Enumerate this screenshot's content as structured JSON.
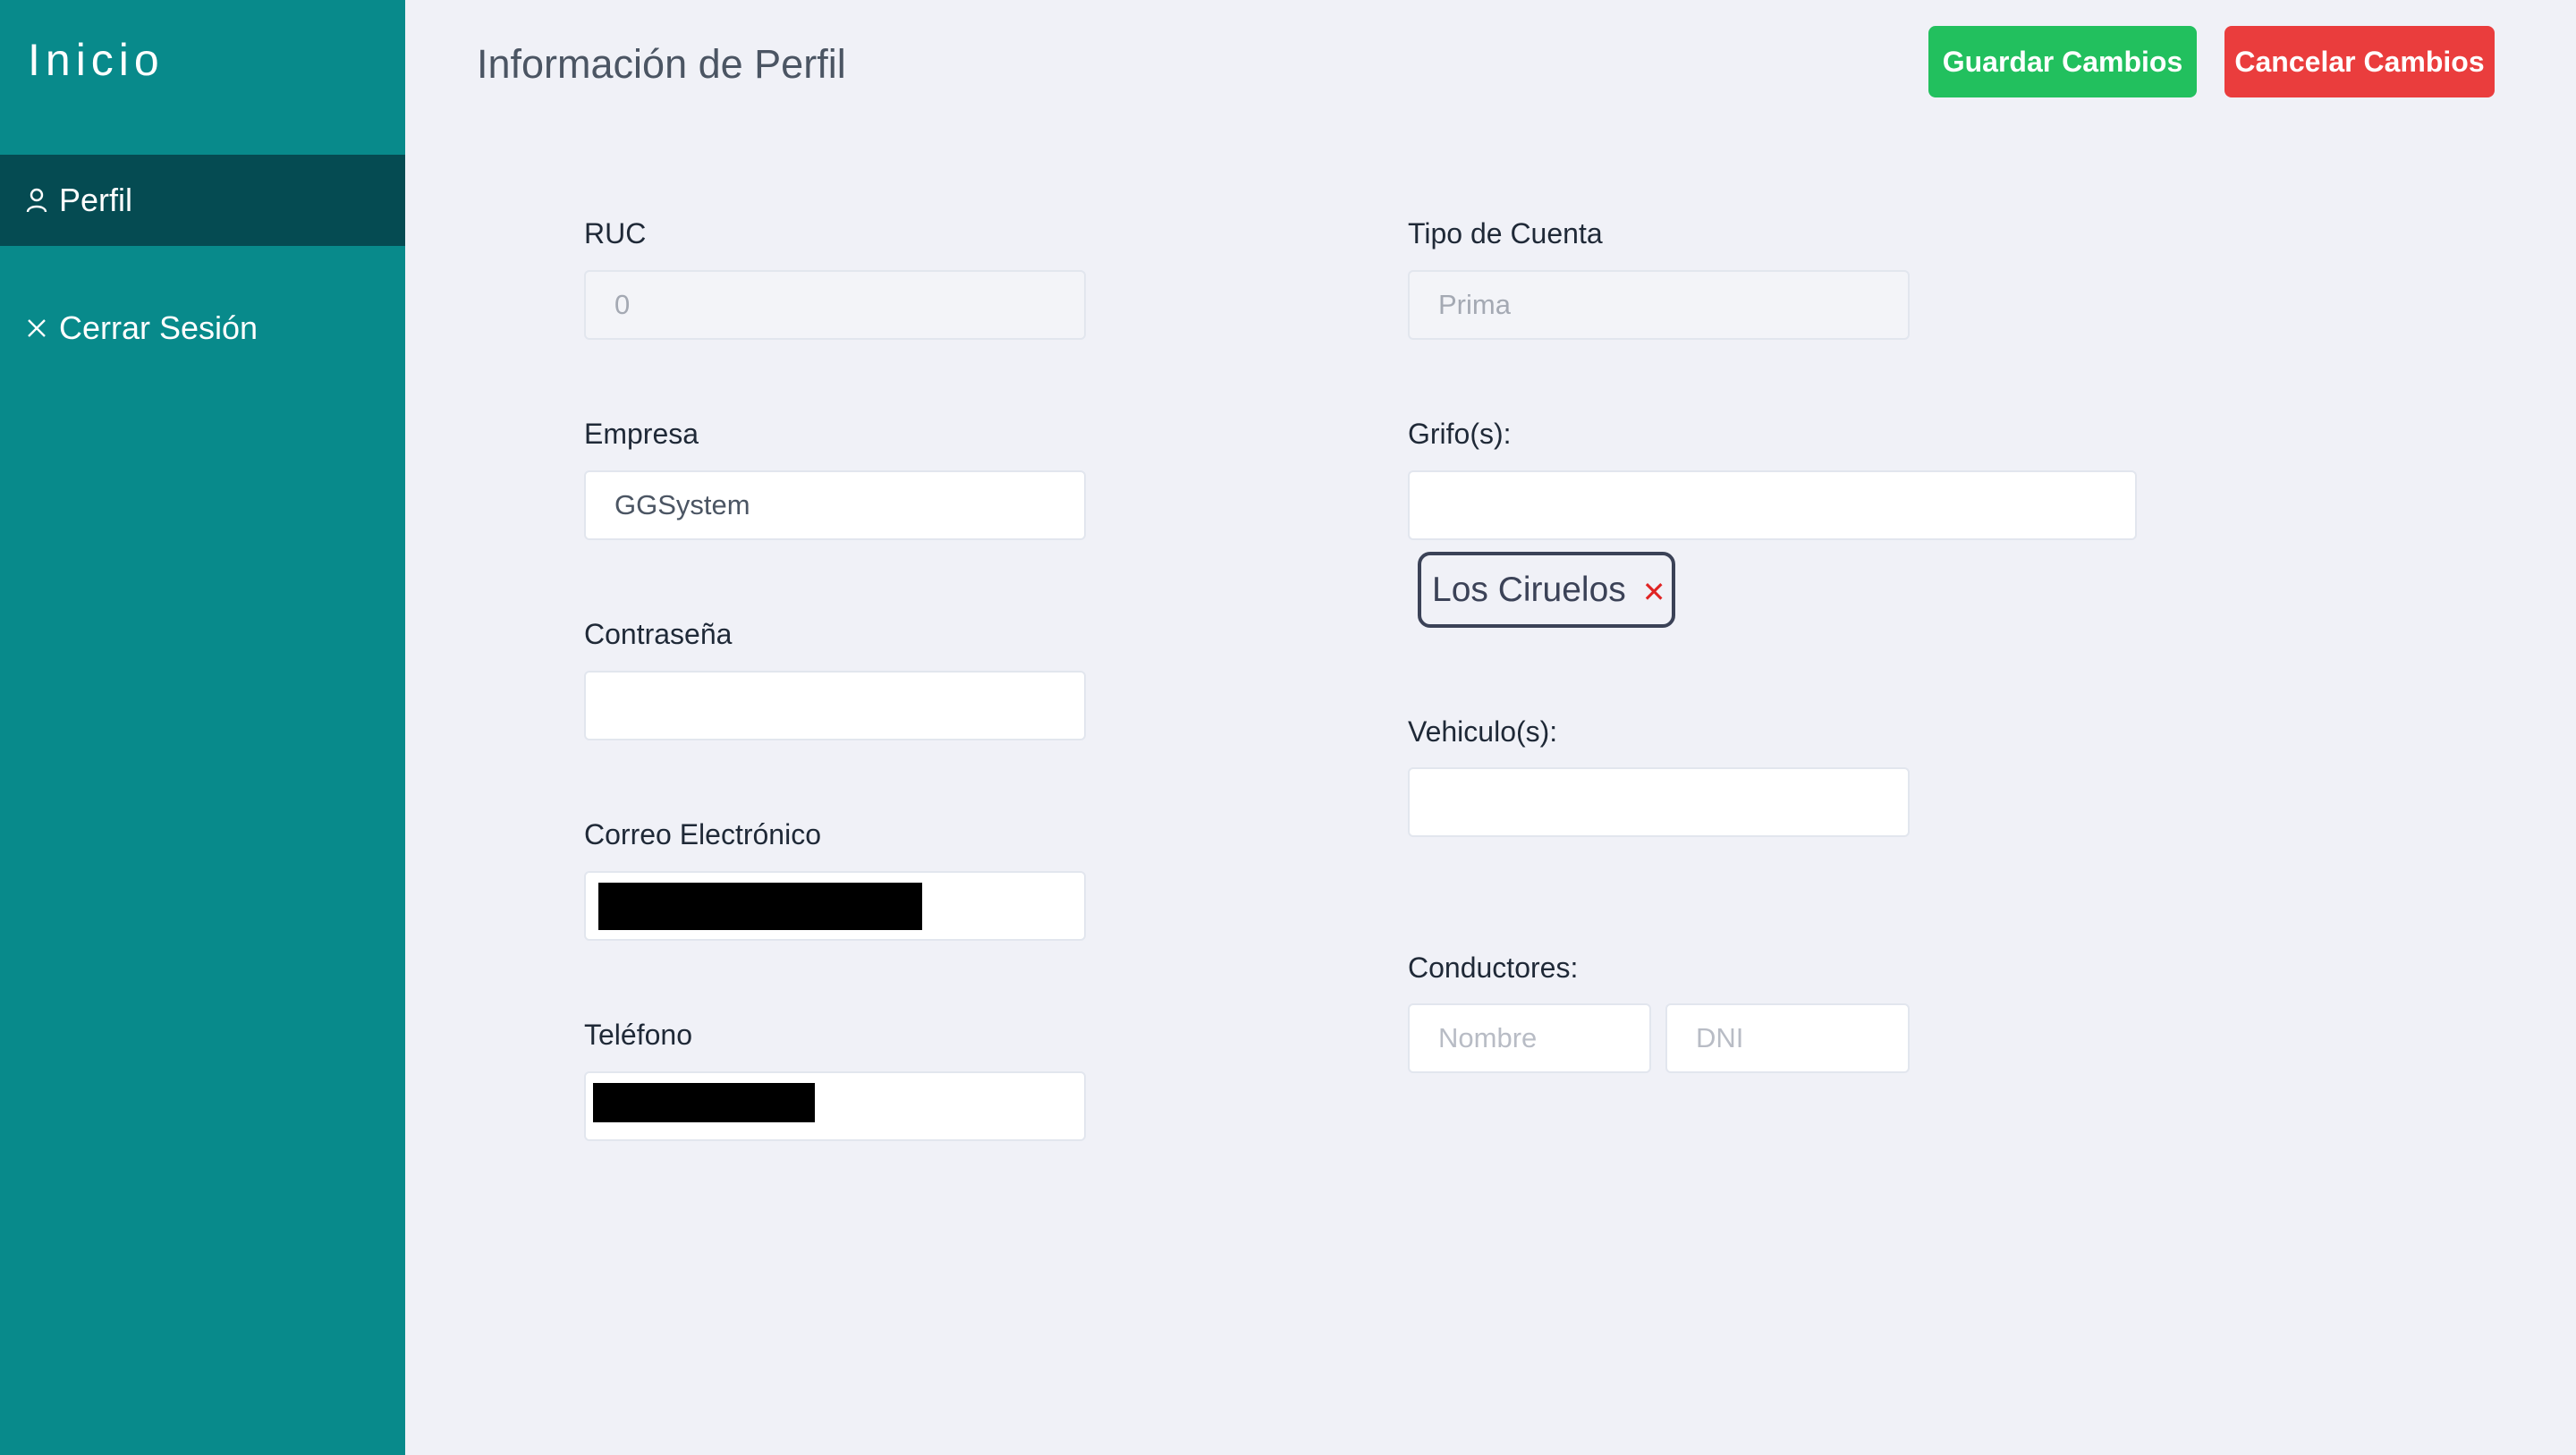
{
  "sidebar": {
    "brand": "Inicio",
    "items": [
      {
        "label": "Perfil",
        "icon": "user-icon",
        "active": true
      },
      {
        "label": "Cerrar Sesión",
        "icon": "close-icon",
        "active": false
      }
    ]
  },
  "header": {
    "title": "Información de Perfil",
    "save_label": "Guardar Cambios",
    "cancel_label": "Cancelar Cambios"
  },
  "form": {
    "ruc": {
      "label": "RUC",
      "value": "0"
    },
    "tipo_cuenta": {
      "label": "Tipo de Cuenta",
      "value": "Prima"
    },
    "empresa": {
      "label": "Empresa",
      "value": "GGSystem"
    },
    "grifos": {
      "label": "Grifo(s):",
      "value": "",
      "chips": [
        {
          "label": "Los Ciruelos"
        }
      ]
    },
    "contrasena": {
      "label": "Contraseña",
      "value": ""
    },
    "vehiculos": {
      "label": "Vehiculo(s):",
      "value": ""
    },
    "correo": {
      "label": "Correo Electrónico",
      "value": ""
    },
    "conductores": {
      "label": "Conductores:",
      "nombre_placeholder": "Nombre",
      "dni_placeholder": "DNI"
    },
    "telefono": {
      "label": "Teléfono",
      "value": ""
    }
  },
  "colors": {
    "sidebar_bg": "#088a8b",
    "sidebar_active": "#054b52",
    "save": "#22c05e",
    "cancel": "#ea3d3d",
    "page_bg": "#f0f1f7"
  }
}
